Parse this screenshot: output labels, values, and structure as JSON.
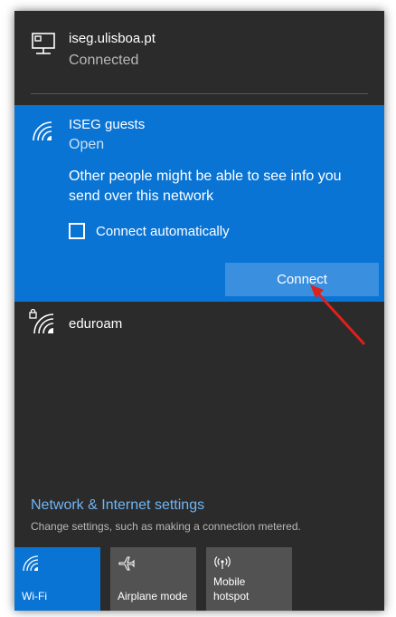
{
  "connected_network": {
    "name": "iseg.ulisboa.pt",
    "status": "Connected",
    "icon": "ethernet-icon"
  },
  "selected_network": {
    "name": "ISEG guests",
    "status": "Open",
    "icon": "wifi-icon",
    "warning": "Other people might be able to see info you send over this network",
    "auto_connect_label": "Connect automatically",
    "auto_connect_checked": false,
    "connect_label": "Connect",
    "color": "#0a74d4"
  },
  "other_networks": [
    {
      "name": "eduroam",
      "icon": "wifi-lock-icon"
    }
  ],
  "settings": {
    "link": "Network & Internet settings",
    "description": "Change settings, such as making a connection metered."
  },
  "quick_actions": [
    {
      "label": "Wi-Fi",
      "icon": "wifi-icon",
      "active": true
    },
    {
      "label": "Airplane mode",
      "icon": "airplane-icon",
      "active": false
    },
    {
      "label": "Mobile\nhotspot",
      "icon": "hotspot-icon",
      "active": false
    }
  ],
  "annotation": {
    "color": "#e0201b"
  }
}
